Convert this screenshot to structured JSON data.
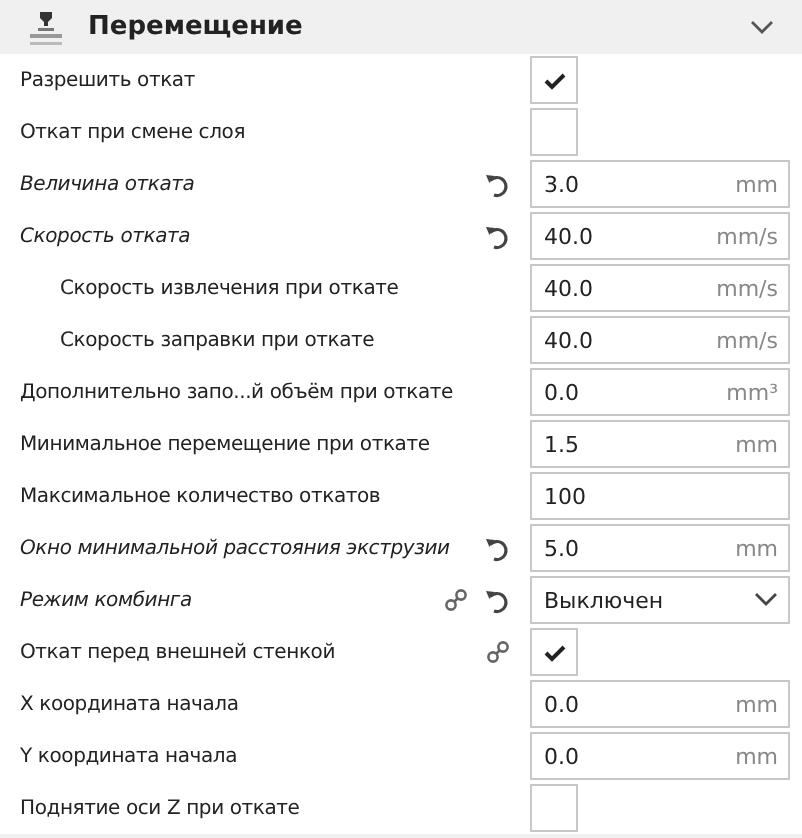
{
  "section": {
    "title": "Перемещение",
    "expanded": true
  },
  "rows": [
    {
      "kind": "checkbox",
      "label": "Разрешить откат",
      "modified": false,
      "linked": false,
      "resettable": false,
      "checked": true
    },
    {
      "kind": "checkbox",
      "label": "Откат при смене слоя",
      "modified": false,
      "linked": false,
      "resettable": false,
      "checked": false
    },
    {
      "kind": "number",
      "label": "Величина отката",
      "modified": true,
      "linked": false,
      "resettable": true,
      "value": "3.0",
      "unit": "mm"
    },
    {
      "kind": "number",
      "label": "Скорость отката",
      "modified": true,
      "linked": false,
      "resettable": true,
      "value": "40.0",
      "unit": "mm/s",
      "children": [
        {
          "kind": "number",
          "label": "Скорость извлечения при откате",
          "modified": false,
          "linked": false,
          "resettable": false,
          "value": "40.0",
          "unit": "mm/s"
        },
        {
          "kind": "number",
          "label": "Скорость заправки при откате",
          "modified": false,
          "linked": false,
          "resettable": false,
          "value": "40.0",
          "unit": "mm/s"
        }
      ]
    },
    {
      "kind": "number",
      "label": "Дополнительно запо...й объём при откате",
      "modified": false,
      "linked": false,
      "resettable": false,
      "value": "0.0",
      "unit": "mm³"
    },
    {
      "kind": "number",
      "label": "Минимальное перемещение при откате",
      "modified": false,
      "linked": false,
      "resettable": false,
      "value": "1.5",
      "unit": "mm"
    },
    {
      "kind": "number",
      "label": "Максимальное количество откатов",
      "modified": false,
      "linked": false,
      "resettable": false,
      "value": "100"
    },
    {
      "kind": "number",
      "label": "Окно минимальной расстояния экструзии",
      "modified": true,
      "linked": false,
      "resettable": true,
      "value": "5.0",
      "unit": "mm"
    },
    {
      "kind": "select",
      "label": "Режим комбинга",
      "modified": true,
      "linked": true,
      "resettable": true,
      "value": "Выключен"
    },
    {
      "kind": "checkbox",
      "label": "Откат перед внешней стенкой",
      "modified": false,
      "linked": true,
      "resettable": false,
      "checked": true
    },
    {
      "kind": "number",
      "label": "X координата начала",
      "modified": false,
      "linked": false,
      "resettable": false,
      "value": "0.0",
      "unit": "mm"
    },
    {
      "kind": "number",
      "label": "Y координата начала",
      "modified": false,
      "linked": false,
      "resettable": false,
      "value": "0.0",
      "unit": "mm"
    },
    {
      "kind": "checkbox",
      "label": "Поднятие оси Z при откате",
      "modified": false,
      "linked": false,
      "resettable": false,
      "checked": false
    }
  ]
}
